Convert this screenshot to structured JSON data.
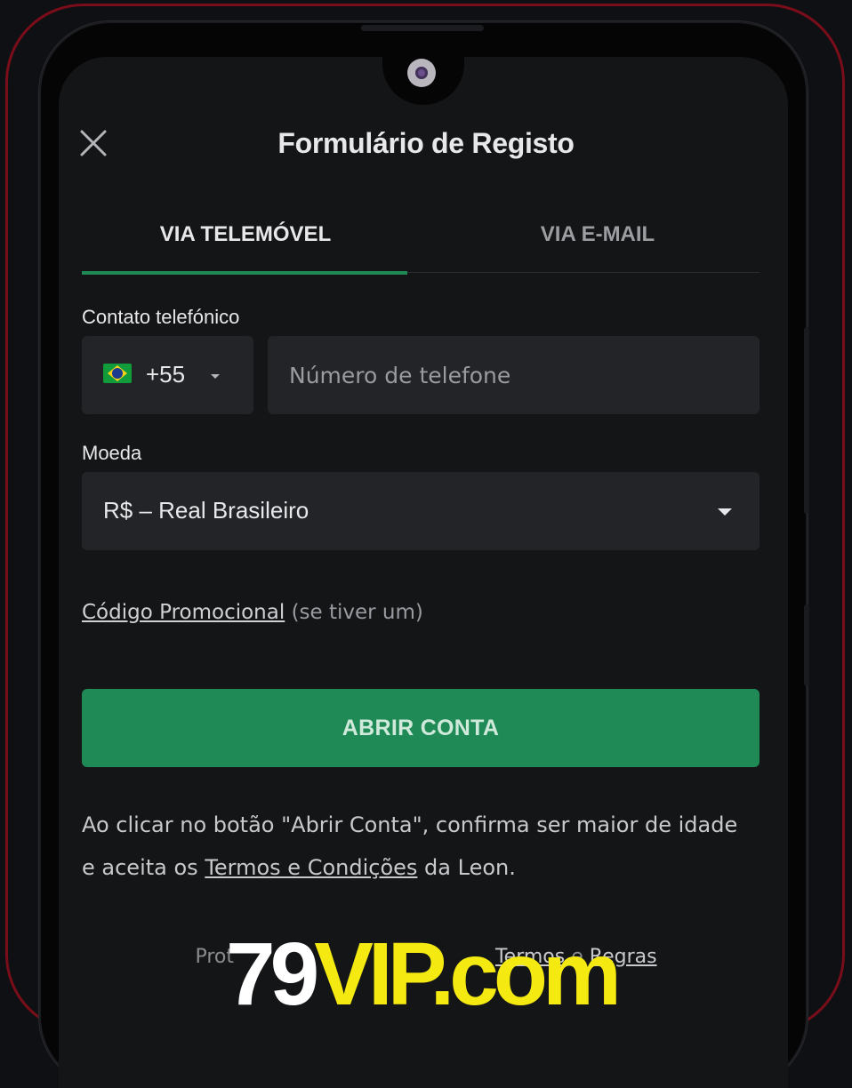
{
  "header": {
    "title": "Formulário de Registo",
    "close_icon": "close-icon"
  },
  "tabs": [
    {
      "label": "VIA TELEMÓVEL",
      "active": true
    },
    {
      "label": "VIA E-MAIL",
      "active": false
    }
  ],
  "phone": {
    "label": "Contato telefónico",
    "country_code": "+55",
    "country_flag": "brazil-flag-icon",
    "placeholder": "Número de telefone"
  },
  "currency": {
    "label": "Moeda",
    "value": "R$ – Real Brasileiro"
  },
  "promo": {
    "link": "Código Promocional",
    "hint": "(se tiver um)"
  },
  "submit": {
    "label": "ABRIR CONTA"
  },
  "terms": {
    "text_before": "Ao clicar no botão \"Abrir Conta\", confirma ser maior de idade e aceita os",
    "link": "Termos e Condições",
    "text_after": "da Leon."
  },
  "footer": {
    "prefix": "Prot",
    "link_terms": "Termos",
    "connector": "e",
    "link_rules": "Regras"
  },
  "watermark": {
    "number": "79",
    "rest": "VIP.com"
  },
  "colors": {
    "accent": "#1f8a55",
    "background": "#141517",
    "input_bg": "#222427",
    "frame_border": "#7a0d1a",
    "watermark_yellow": "#f4ea12"
  }
}
